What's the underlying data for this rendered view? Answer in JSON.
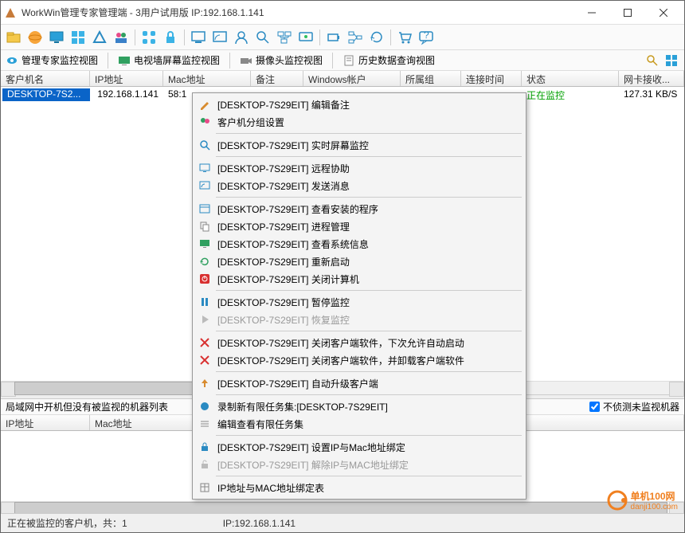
{
  "window": {
    "title": "WorkWin管理专家管理端 - 3用户试用版 IP:192.168.1.141"
  },
  "viewbar": {
    "monitor": "管理专家监控视图",
    "tvwall": "电视墙屏幕监控视图",
    "camera": "摄像头监控视图",
    "history": "历史数据查询视图"
  },
  "columns": {
    "client": "客户机名",
    "ip": "IP地址",
    "mac": "Mac地址",
    "remark": "备注",
    "winaccount": "Windows帐户",
    "group": "所属组",
    "conntime": "连接时间",
    "status": "状态",
    "netcard": "网卡接收..."
  },
  "row": {
    "client": "DESKTOP-7S2...",
    "ip": "192.168.1.141",
    "mac": "58:1",
    "status": "正在监控",
    "netcard": "127.31 KB/S"
  },
  "bottom": {
    "title": "局域网中开机但没有被监视的机器列表",
    "checkbox": "不侦测未监视机器",
    "col_ip": "IP地址",
    "col_mac": "Mac地址"
  },
  "status": {
    "left": "正在被监控的客户机，共：1",
    "ip": "IP:192.168.1.141"
  },
  "watermark": {
    "brand": "单机100网",
    "url": "danji100.com"
  },
  "menu": {
    "edit_remark": "[DESKTOP-7S29EIT] 编辑备注",
    "group_settings": "客户机分组设置",
    "realtime": "[DESKTOP-7S29EIT] 实时屏幕监控",
    "remote_assist": "[DESKTOP-7S29EIT] 远程协助",
    "send_msg": "[DESKTOP-7S29EIT] 发送消息",
    "installed": "[DESKTOP-7S29EIT] 查看安装的程序",
    "process": "[DESKTOP-7S29EIT] 进程管理",
    "sysinfo": "[DESKTOP-7S29EIT] 查看系统信息",
    "restart": "[DESKTOP-7S29EIT] 重新启动",
    "shutdown": "[DESKTOP-7S29EIT] 关闭计算机",
    "pause": "[DESKTOP-7S29EIT] 暂停监控",
    "resume": "[DESKTOP-7S29EIT] 恢复监控",
    "close_auto": "[DESKTOP-7S29EIT] 关闭客户端软件，下次允许自动启动",
    "close_uninstall": "[DESKTOP-7S29EIT] 关闭客户端软件，并卸载客户端软件",
    "upgrade": "[DESKTOP-7S29EIT] 自动升级客户端",
    "record_new": "录制新有限任务集:[DESKTOP-7S29EIT]",
    "edit_view": "编辑查看有限任务集",
    "bind_mac": "[DESKTOP-7S29EIT] 设置IP与Mac地址绑定",
    "unbind_mac": "[DESKTOP-7S29EIT] 解除IP与MAC地址绑定",
    "bind_table": "IP地址与MAC地址绑定表"
  }
}
